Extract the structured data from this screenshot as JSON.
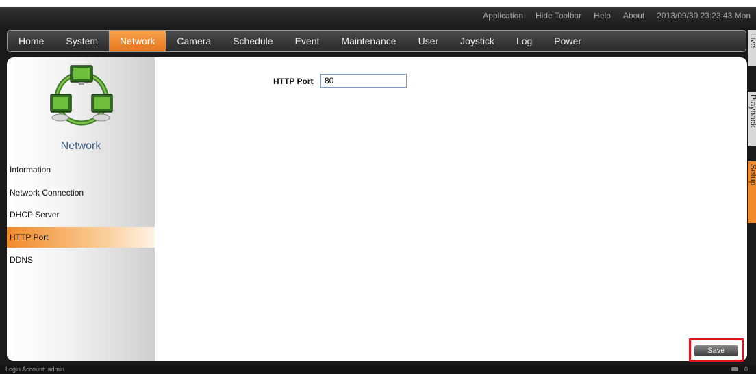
{
  "toolbar": {
    "links": [
      "Application",
      "Hide Toolbar",
      "Help",
      "About"
    ],
    "datetime": "2013/09/30 23:23:43 Mon"
  },
  "nav": {
    "items": [
      "Home",
      "System",
      "Network",
      "Camera",
      "Schedule",
      "Event",
      "Maintenance",
      "User",
      "Joystick",
      "Log",
      "Power"
    ],
    "active": "Network"
  },
  "sidebar": {
    "title": "Network",
    "items": [
      "Information",
      "Network Connection",
      "DHCP Server",
      "HTTP Port",
      "DDNS"
    ],
    "active": "HTTP Port"
  },
  "main": {
    "http_port_label": "HTTP Port",
    "http_port_value": "80"
  },
  "save_label": "Save",
  "side_tabs": [
    "Live",
    "Playback",
    "Setup"
  ],
  "side_tabs_active": "Setup",
  "status": {
    "login": "Login Account: admin",
    "count": "0"
  },
  "colors": {
    "accent": "#f08a2a",
    "highlight_border": "#e0131b",
    "sidebar_title": "#3b5c80"
  }
}
